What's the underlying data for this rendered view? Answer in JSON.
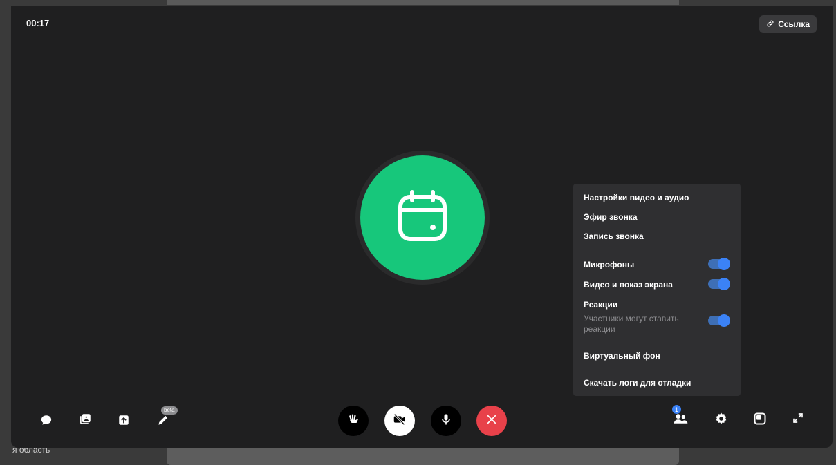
{
  "timer": "00:17",
  "link_button": {
    "label": "Ссылка",
    "icon": "link-icon"
  },
  "avatar": {
    "icon": "calendar-icon",
    "color": "#17c77b"
  },
  "background_text": "я область",
  "menu": {
    "items": [
      "Настройки видео и аудио",
      "Эфир звонка",
      "Запись звонка"
    ],
    "toggles": [
      {
        "label": "Микрофоны",
        "on": true
      },
      {
        "label": "Видео и показ экрана",
        "on": true
      },
      {
        "label": "Реакции",
        "sub": "Участники могут ставить реакции",
        "on": true
      }
    ],
    "virtual_bg": "Виртуальный фон",
    "download_logs": "Скачать логи для отладки"
  },
  "toolbar_left": [
    {
      "icon": "chat-icon"
    },
    {
      "icon": "contacts-icon"
    },
    {
      "icon": "share-screen-icon"
    },
    {
      "icon": "pen-icon",
      "badge": "beta"
    }
  ],
  "toolbar_center": [
    {
      "icon": "raise-hand-icon"
    },
    {
      "icon": "video-off-icon"
    },
    {
      "icon": "microphone-icon"
    },
    {
      "icon": "end-call-icon",
      "color": "#e8414a"
    }
  ],
  "toolbar_right": {
    "participants_count": "1"
  },
  "colors": {
    "accent": "#3b82f6",
    "bg": "#1f1f20",
    "danger": "#e8414a"
  }
}
